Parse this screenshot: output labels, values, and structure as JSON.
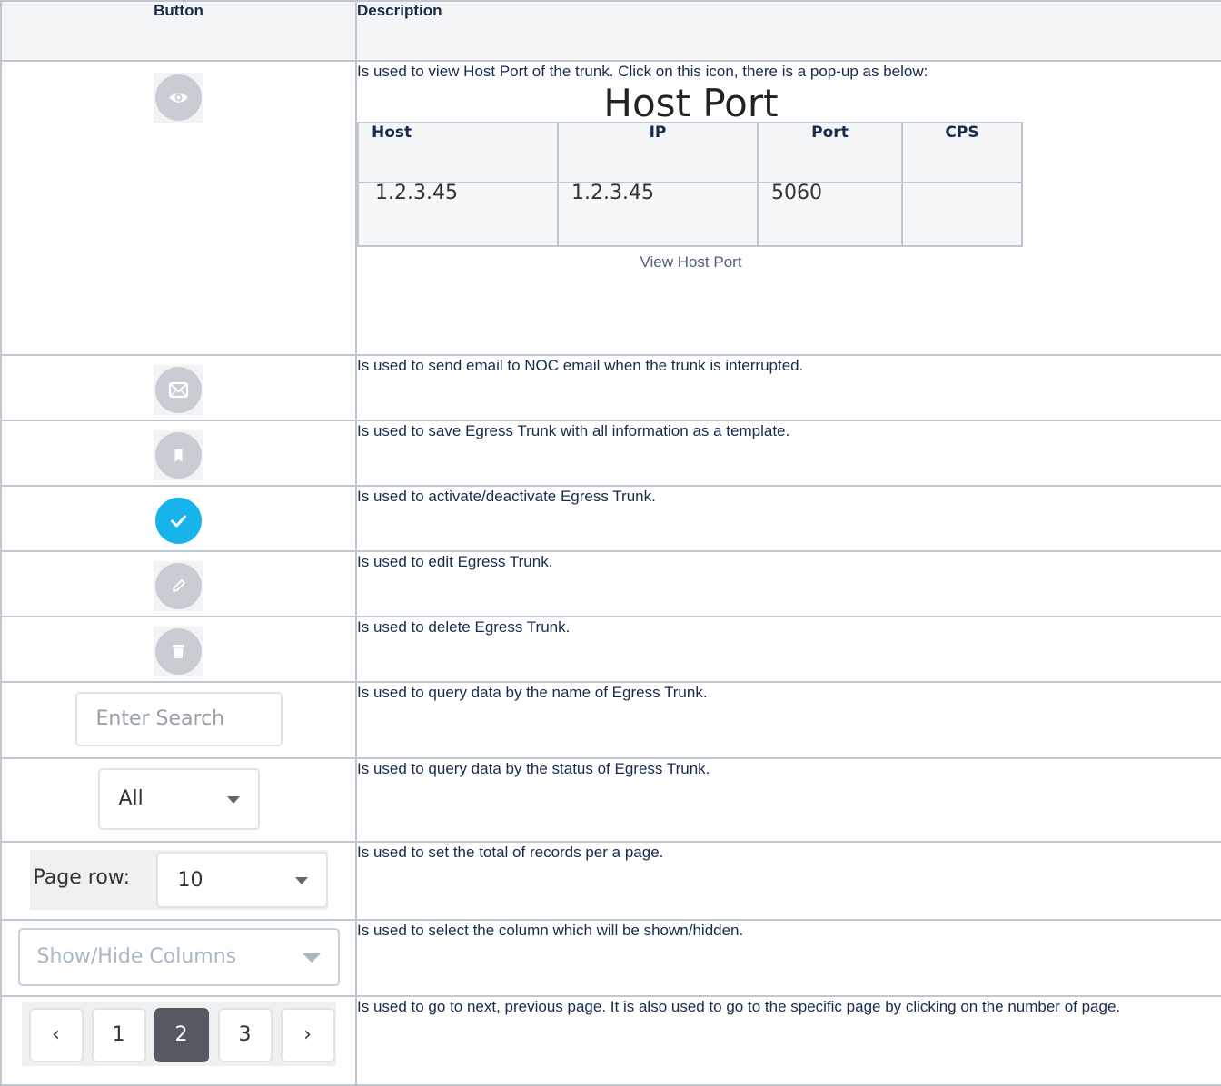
{
  "headers": {
    "button": "Button",
    "description": "Description"
  },
  "rows": [
    {
      "icon": "eye-icon",
      "description": "Is used to view Host Port of the trunk. Click on this icon, there is a pop-up as below:",
      "popup": {
        "title": "Host Port",
        "columns": [
          "Host",
          "IP",
          "Port",
          "CPS"
        ],
        "row": [
          "1.2.3.45",
          "1.2.3.45",
          "5060",
          ""
        ],
        "caption": "View Host Port"
      }
    },
    {
      "icon": "email-icon",
      "description": "Is used to send email to NOC email when the trunk is interrupted."
    },
    {
      "icon": "bookmark-icon",
      "description": "Is used to save Egress Trunk with all information as a template."
    },
    {
      "icon": "check-icon",
      "description": "Is used to activate/deactivate Egress Trunk."
    },
    {
      "icon": "pencil-icon",
      "description": "Is used to edit Egress Trunk."
    },
    {
      "icon": "trash-icon",
      "description": "Is used to delete Egress Trunk."
    },
    {
      "control": {
        "placeholder": "Enter Search"
      },
      "description": "Is used to query data by the name of Egress Trunk."
    },
    {
      "control": {
        "value": "All"
      },
      "description": "Is used to query data by the status of Egress Trunk."
    },
    {
      "control": {
        "label": "Page row:",
        "value": "10"
      },
      "description": "Is used to set the total of records per a page."
    },
    {
      "control": {
        "placeholder": "Show/Hide Columns"
      },
      "description": "Is used to select the column which will be shown/hidden."
    },
    {
      "control": {
        "prev": "‹",
        "pages": [
          "1",
          "2",
          "3"
        ],
        "active_page": "2",
        "next": "›"
      },
      "description": "Is used to go to next, previous page. It is also used to go to the specific page by clicking on the number of page."
    }
  ],
  "colors": {
    "icon_gray": "#c9ccd3",
    "icon_active": "#17b4ec",
    "border": "#c1c7d0"
  }
}
